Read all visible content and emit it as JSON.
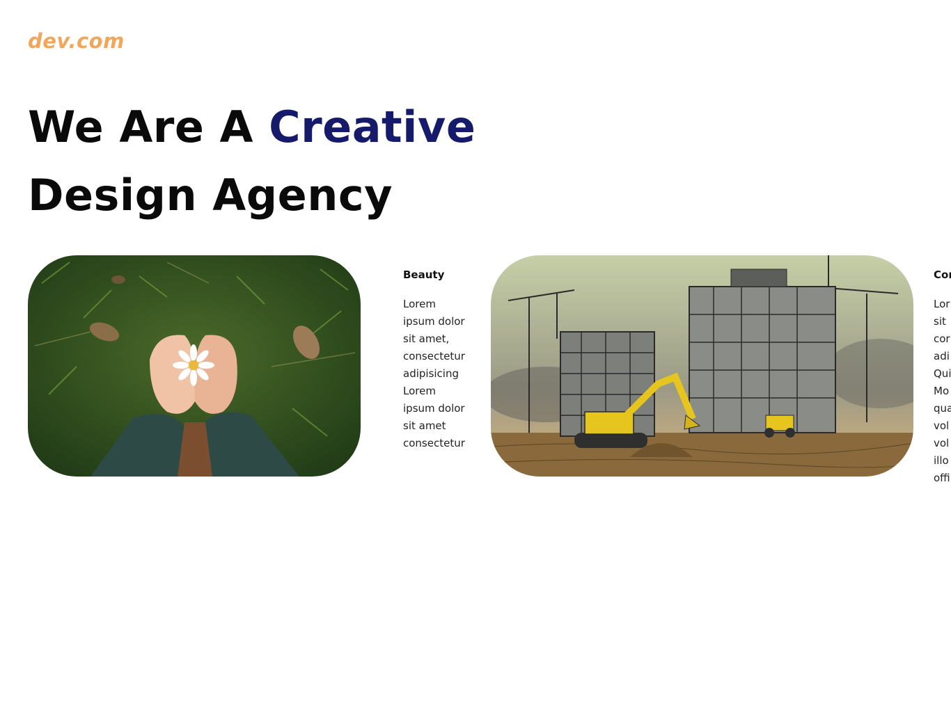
{
  "brand": {
    "logo_text": "dev.com",
    "accent": "#f2a65a"
  },
  "hero": {
    "line1_pre": "We Are A ",
    "line1_accent": "Creative",
    "line2": "Design Agency",
    "accent_color": "#161a6b"
  },
  "cards": [
    {
      "title": "Beauty",
      "body": "Lorem\nipsum dolor\nsit amet,\nconsectetur\nadipisicing\nLorem\nipsum dolor\nsit amet\nconsectetur",
      "image": "hands-holding-daisy-on-grass"
    },
    {
      "title": "Cor",
      "body": "Lor\nsit\ncor\nadi\nQui\nMo\nqua\nvol\nvol\nillo\noffi",
      "image": "construction-site-sketch"
    }
  ]
}
